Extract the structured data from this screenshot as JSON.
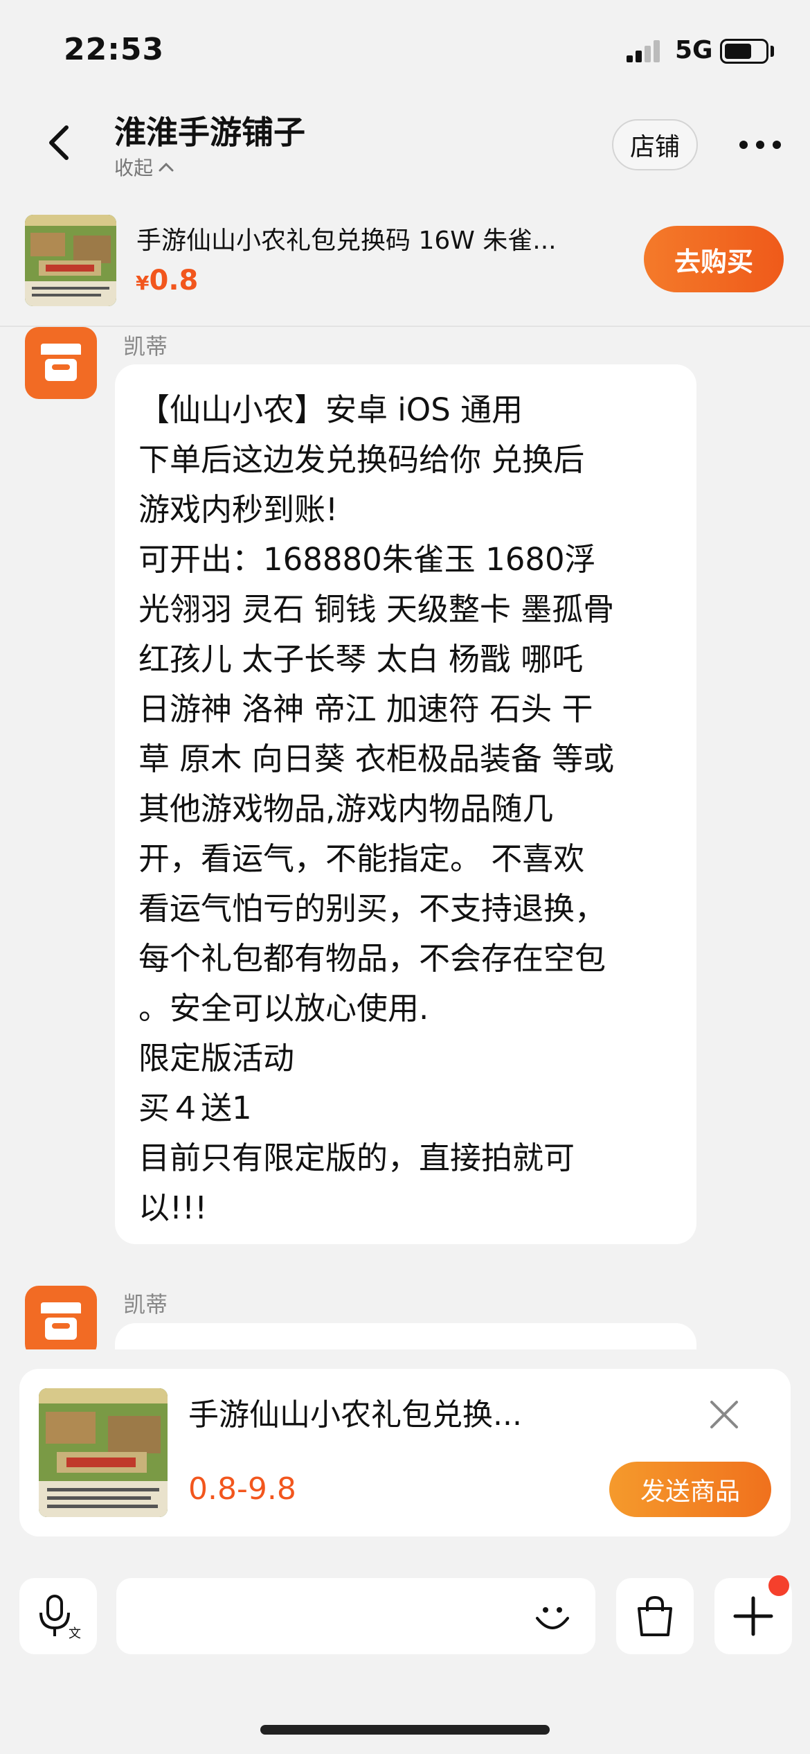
{
  "status_bar": {
    "time": "22:53",
    "network": "5G"
  },
  "header": {
    "title": "淮淮手游铺子",
    "collapse_label": "收起",
    "store_label": "店铺"
  },
  "product_bar": {
    "title": "手游仙山小农礼包兑换码 16W 朱雀...",
    "currency": "¥",
    "price": "0.8",
    "buy_label": "去购买"
  },
  "messages": [
    {
      "sender": "凯蒂",
      "lines": [
        "【仙山小农】安卓 iOS 通用",
        "下单后这边发兑换码给你 兑换后",
        "游戏内秒到账!",
        "可开出：168880朱雀玉  1680浮",
        "光翎羽 灵石 铜钱 天级整卡 墨孤骨",
        "红孩儿 太子长琴 太白 杨戬 哪吒",
        "日游神 洛神 帝江 加速符 石头 干",
        "草 原木 向日葵 衣柜极品装备 等或",
        "其他游戏物品,游戏内物品随几",
        "开，看运气，不能指定。 不喜欢",
        "看运气怕亏的别买，不支持退换，",
        "每个礼包都有物品，不会存在空包",
        "。安全可以放心使用.",
        "限定版活动",
        "买４送1",
        "目前只有限定版的，直接拍就可",
        "以!!!"
      ]
    },
    {
      "sender": "凯蒂"
    }
  ],
  "product_card": {
    "title": "手游仙山小农礼包兑换...",
    "price_range": "0.8-9.8",
    "send_label": "发送商品"
  },
  "input_bar": {
    "placeholder": ""
  },
  "icons": {
    "back": "chevron-left-icon",
    "more": "more-dots-icon",
    "voice": "voice-to-text-icon",
    "emoji": "smile-icon",
    "bag": "shopping-bag-icon",
    "plus": "plus-icon",
    "close": "close-icon",
    "shop_avatar": "store-icon"
  },
  "colors": {
    "accent": "#f2561d",
    "buy_button": "#f06a22",
    "send_button": "#f28526",
    "avatar": "#f26b24",
    "notification_dot": "#f5402c"
  }
}
